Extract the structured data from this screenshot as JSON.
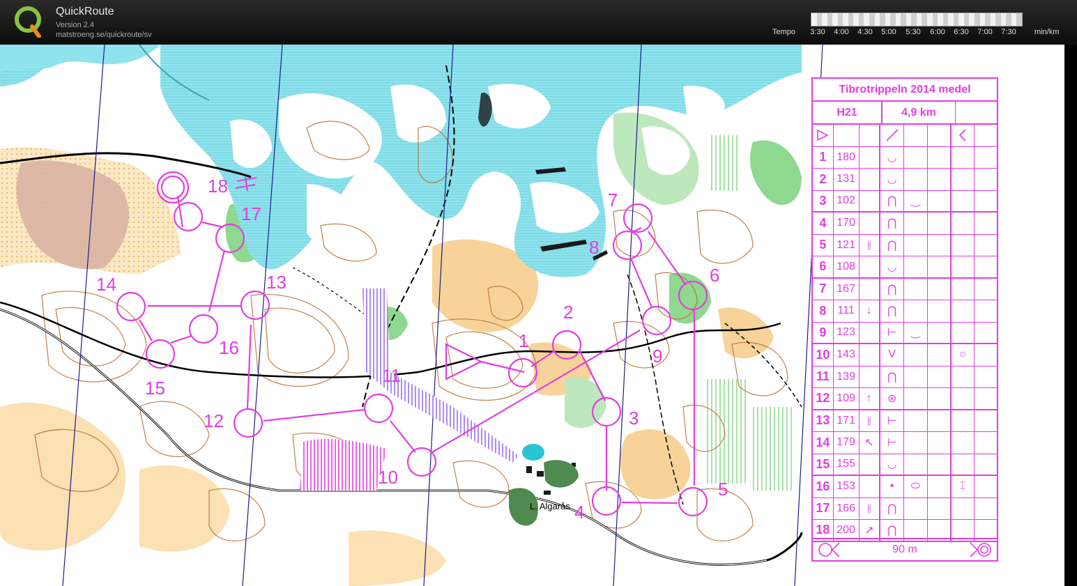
{
  "app": {
    "title": "QuickRoute",
    "version": "Version 2.4",
    "url": "matstroeng.se/quickroute/sv"
  },
  "tempo": {
    "label": "Tempo",
    "ticks": [
      "3:30",
      "4:00",
      "4:30",
      "5:00",
      "5:30",
      "6:00",
      "6:30",
      "7:00",
      "7:30"
    ],
    "unit": "min/km"
  },
  "colors": {
    "course": "#e23de0",
    "water": "#8fe3ec",
    "open": "#f7d39a",
    "forest_green": "#8fd88f",
    "contour": "#b96a2c"
  },
  "map": {
    "place_name": "L. Algarås"
  },
  "course": {
    "controls": [
      {
        "label": "1"
      },
      {
        "label": "2"
      },
      {
        "label": "3"
      },
      {
        "label": "4"
      },
      {
        "label": "5"
      },
      {
        "label": "6"
      },
      {
        "label": "7"
      },
      {
        "label": "8"
      },
      {
        "label": "9"
      },
      {
        "label": "10"
      },
      {
        "label": "11"
      },
      {
        "label": "12"
      },
      {
        "label": "13"
      },
      {
        "label": "14"
      },
      {
        "label": "15"
      },
      {
        "label": "16"
      },
      {
        "label": "17"
      },
      {
        "label": "18"
      }
    ]
  },
  "description": {
    "title": "Tibrotrippeln 2014 medel",
    "class": "H21",
    "length": "4,9 km",
    "start_symbols": [
      "start-triangle-icon",
      "",
      "",
      "slope-line-icon",
      "",
      "",
      "angle-bracket-icon",
      ""
    ],
    "rows": [
      {
        "num": "1",
        "code": "180",
        "which": "",
        "feature": "◡",
        "detail": "",
        "location": ""
      },
      {
        "num": "2",
        "code": "131",
        "which": "",
        "feature": "◡",
        "detail": "",
        "location": ""
      },
      {
        "num": "3",
        "code": "102",
        "which": "",
        "feature": "⋂",
        "detail": "‿",
        "location": ""
      },
      {
        "num": "4",
        "code": "170",
        "which": "",
        "feature": "⋂",
        "detail": "",
        "location": ""
      },
      {
        "num": "5",
        "code": "121",
        "which": "⫲",
        "feature": "⋂",
        "detail": "",
        "location": ""
      },
      {
        "num": "6",
        "code": "108",
        "which": "",
        "feature": "◡",
        "detail": "",
        "location": ""
      },
      {
        "num": "7",
        "code": "167",
        "which": "",
        "feature": "⋂",
        "detail": "",
        "location": ""
      },
      {
        "num": "8",
        "code": "111",
        "which": "↓",
        "feature": "⋂",
        "detail": "",
        "location": ""
      },
      {
        "num": "9",
        "code": "123",
        "which": "",
        "feature": "⊢",
        "detail": "‿",
        "location": ""
      },
      {
        "num": "10",
        "code": "143",
        "which": "",
        "feature": "V",
        "detail": "",
        "location": "○"
      },
      {
        "num": "11",
        "code": "139",
        "which": "",
        "feature": "⋂",
        "detail": "",
        "location": ""
      },
      {
        "num": "12",
        "code": "109",
        "which": "↑",
        "feature": "⊛",
        "detail": "",
        "location": ""
      },
      {
        "num": "13",
        "code": "171",
        "which": "⫲",
        "feature": "⊢",
        "detail": "",
        "location": ""
      },
      {
        "num": "14",
        "code": "179",
        "which": "↖",
        "feature": "⊢",
        "detail": "",
        "location": ""
      },
      {
        "num": "15",
        "code": "155",
        "which": "",
        "feature": "◡",
        "detail": "",
        "location": ""
      },
      {
        "num": "16",
        "code": "153",
        "which": "",
        "feature": "•",
        "detail": "⬭",
        "location": "⌶"
      },
      {
        "num": "17",
        "code": "166",
        "which": "⫲",
        "feature": "⋂",
        "detail": "",
        "location": ""
      },
      {
        "num": "18",
        "code": "200",
        "which": "↗",
        "feature": "⋂",
        "detail": "",
        "location": ""
      }
    ],
    "finish_distance": "90 m"
  }
}
